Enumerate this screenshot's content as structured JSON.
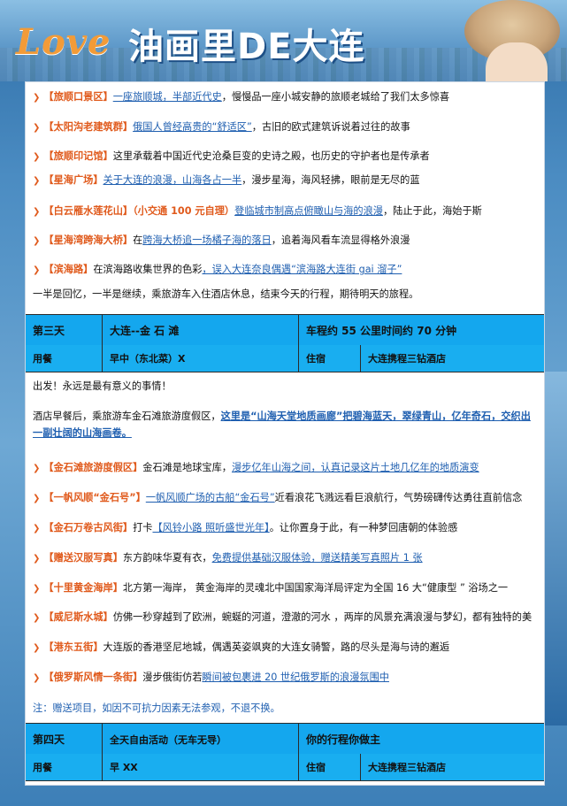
{
  "header": {
    "love": "Love",
    "title": "油画里DE大连"
  },
  "day2_items": [
    {
      "label": "【旅顺口景区】",
      "link": "一座旅顺城，半部近代史",
      "text": "，慢慢品一座小城安静的旅顺老城给了我们太多惊喜"
    },
    {
      "label": "【太阳沟老建筑群】",
      "link": "俄国人曾经高贵的“舒适区”",
      "text": "，古旧的欧式建筑诉说着过往的故事"
    },
    {
      "label": "【旅顺印记馆】",
      "link": "",
      "text": "这里承载着中国近代史沧桑巨变的史诗之殿，也历史的守护者也是传承者"
    },
    {
      "label": "【星海广场】",
      "link": "关于大连的浪漫，山海各占一半",
      "text": "，漫步星海，海风轻拂，眼前是无尽的蓝"
    },
    {
      "label": "【白云雁水莲花山】（小交通 100 元自理）",
      "link": "登临城市制高点俯瞰山与海的浪漫",
      "text": "，陆止于此，海始于斯"
    },
    {
      "label": "【星海湾跨海大桥】",
      "pre": "在",
      "link": "跨海大桥追一场橘子海的落日",
      "text": "，追着海风看车流显得格外浪漫"
    },
    {
      "label": "【滨海路】",
      "pre": "在滨海路收集世界的色彩",
      "link": "，误入大连奈良偶遇“滨海路大连街 gai 溜子”",
      "text": ""
    }
  ],
  "day2_closing": "一半是回忆，一半是继续，乘旅游车入住酒店休息，结束今天的行程，期待明天的旅程。",
  "day3": {
    "day": "第三天",
    "route": "大连--金 石 滩",
    "distance": "车程约 55 公里时间约 70 分钟",
    "meal_label": "用餐",
    "meal": "早中（东北菜）X",
    "stay_label": "住宿",
    "hotel": "大连携程三钻酒店"
  },
  "day3_intro": "出发！永远是最有意义的事情！",
  "day3_para_text": "酒店早餐后，乘旅游车金石滩旅游度假区，",
  "day3_para_link": "这里是“山海天堂地质画廊”把碧海蓝天，翠绿青山，亿年奇石，交织出一副壮阔的山海画卷。",
  "day3_items": [
    {
      "label": "【金石滩旅游度假区】",
      "pre": "金石滩是地球宝库，",
      "link": "漫步亿年山海之间，认真记录这片土地几亿年的地质演变",
      "text": ""
    },
    {
      "label": "【一帆风顺“金石号”】",
      "pre": "",
      "link": "一帆风顺广场的古船“金石号”",
      "text": "近看浪花飞溅远看巨浪航行，气势磅礴传达勇往直前信念"
    },
    {
      "label": "【金石万卷古风街】",
      "pre": "打卡",
      "link": "【风铃小路 照听盛世光年】",
      "text": "。让你置身于此，有一种梦回唐朝的体验感"
    },
    {
      "label": "【赠送汉服写真】",
      "pre": "东方韵味华夏有衣，",
      "link": "免费提供基础汉服体验，赠送精美写真照片 1 张",
      "text": ""
    },
    {
      "label": "【十里黄金海岸】",
      "pre": "",
      "link": "",
      "text": "北方第一海岸， 黄金海岸的灵魂北中国国家海洋局评定为全国 16 大“健康型 ” 浴场之一"
    },
    {
      "label": "【威尼斯水城】",
      "pre": "",
      "link": "",
      "text": "仿佛一秒穿越到了欧洲，蜿蜒的河道，澄澈的河水 ，两岸的风景充满浪漫与梦幻，都有独特的美"
    },
    {
      "label": "【港东五街】",
      "pre": "",
      "link": "",
      "text": "大连版的香港坚尼地城，偶遇英姿飒爽的大连女骑警，路的尽头是海与诗的邂逅"
    },
    {
      "label": "【俄罗斯风情一条街】",
      "pre": "漫步俄街仿若",
      "link": "瞬间被包裹进 20 世纪俄罗斯的浪漫氛围中",
      "text": ""
    }
  ],
  "day3_note": "注：赠送项目，如因不可抗力因素无法参观，不退不换。",
  "day4": {
    "day": "第四天",
    "route": "全天自由活动（无车无导）",
    "distance": "你的行程你做主",
    "meal_label": "用餐",
    "meal": "早 XX",
    "stay_label": "住宿",
    "hotel": "大连携程三钻酒店"
  },
  "colors": {
    "label_orange": "#e05a1c",
    "link_blue": "#1f5fb0",
    "table_blue": "#14a7ee"
  },
  "icons": {
    "bullet": "orange-diamond-bullet-icon"
  }
}
